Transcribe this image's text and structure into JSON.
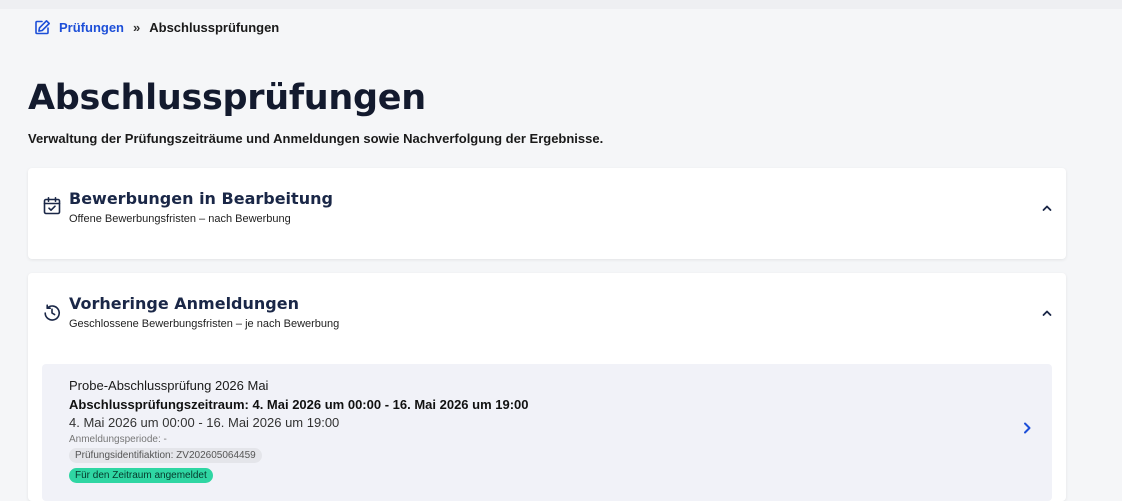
{
  "breadcrumb": {
    "icon": "edit-icon",
    "parent": "Prüfungen",
    "separator": "»",
    "current": "Abschlussprüfungen"
  },
  "page": {
    "title": "Abschlussprüfungen",
    "subtitle": "Verwaltung der Prüfungszeiträume und Anmeldungen sowie Nachverfolgung der Ergebnisse."
  },
  "sections": [
    {
      "icon": "calendar-check-icon",
      "title": "Bewerbungen in Bearbeitung",
      "subtitle": "Offene Bewerbungsfristen – nach Bewerbung",
      "expanded": true
    },
    {
      "icon": "history-icon",
      "title": "Vorheringe Anmeldungen",
      "subtitle": "Geschlossene Bewerbungsfristen – je nach Bewerbung",
      "expanded": true,
      "items": [
        {
          "name": "Probe-Abschlussprüfung 2026 Mai",
          "range": "Abschlussprüfungszeitraum: 4. Mai 2026 um 00:00 - 16. Mai 2026 um 19:00",
          "date": "4. Mai 2026 um 00:00 - 16. Mai 2026 um 19:00",
          "period": "Anmeldungsperiode: -",
          "identifier": "Prüfungsidentifiaktion: ZV202605064459",
          "status": "Für den Zeitraum angemeldet"
        }
      ]
    }
  ],
  "colors": {
    "link": "#1d4fd8",
    "title": "#131a2e",
    "section_title": "#1a2747",
    "badge_bg": "#2fd6a3",
    "card_item_bg": "#f1f2f8"
  }
}
